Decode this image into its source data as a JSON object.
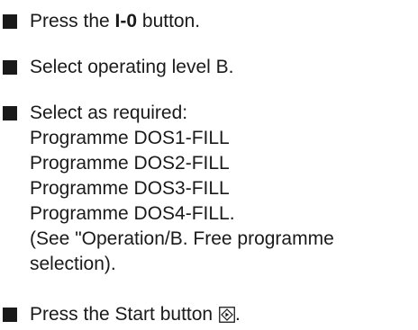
{
  "steps": [
    {
      "prefix": "Press the ",
      "bold": "I-0",
      "suffix": " button."
    },
    {
      "text": "Select operating level B."
    },
    {
      "lines": [
        "Select as required:",
        "Programme DOS1-FILL",
        "Programme DOS2-FILL",
        "Programme DOS3-FILL",
        "Programme DOS4-FILL.",
        "(See \"Operation/B. Free programme",
        "selection)."
      ]
    },
    {
      "prefix": "Press the Start button ",
      "icon": "start-button-icon",
      "suffix": "."
    }
  ]
}
